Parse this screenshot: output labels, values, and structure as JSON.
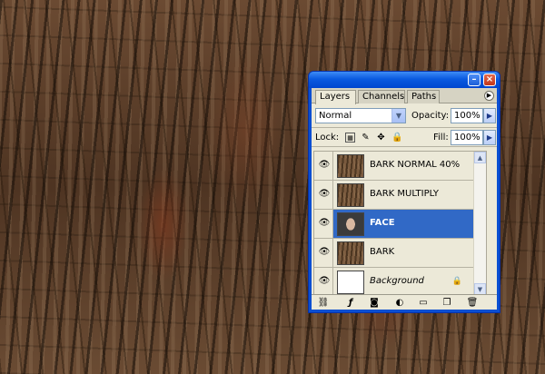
{
  "panel": {
    "tabs": [
      {
        "label": "Layers",
        "active": true
      },
      {
        "label": "Channels",
        "active": false
      },
      {
        "label": "Paths",
        "active": false
      }
    ],
    "blend_mode": "Normal",
    "opacity_label": "Opacity:",
    "opacity": "100%",
    "lock_label": "Lock:",
    "fill_label": "Fill:",
    "fill": "100%"
  },
  "layers": [
    {
      "name": "BARK NORMAL 40%",
      "thumb": "bark",
      "visible": true,
      "selected": false
    },
    {
      "name": "BARK MULTIPLY",
      "thumb": "bark",
      "visible": true,
      "selected": false
    },
    {
      "name": "FACE",
      "thumb": "face",
      "visible": true,
      "selected": true
    },
    {
      "name": "BARK",
      "thumb": "bark",
      "visible": true,
      "selected": false
    },
    {
      "name": "Background",
      "thumb": "white",
      "visible": true,
      "selected": false,
      "locked": true
    }
  ],
  "icons": {
    "eye": "eye-icon",
    "lock": "lock-icon",
    "link": "link-layers-icon",
    "fx": "layer-style-icon",
    "mask": "layer-mask-icon",
    "adjust": "adjustment-layer-icon",
    "folder": "new-group-icon",
    "new": "new-layer-icon",
    "trash": "delete-layer-icon"
  },
  "colors": {
    "titlebar": "#0a5ae0",
    "selection": "#3169c6",
    "panel_bg": "#ece9d8"
  }
}
